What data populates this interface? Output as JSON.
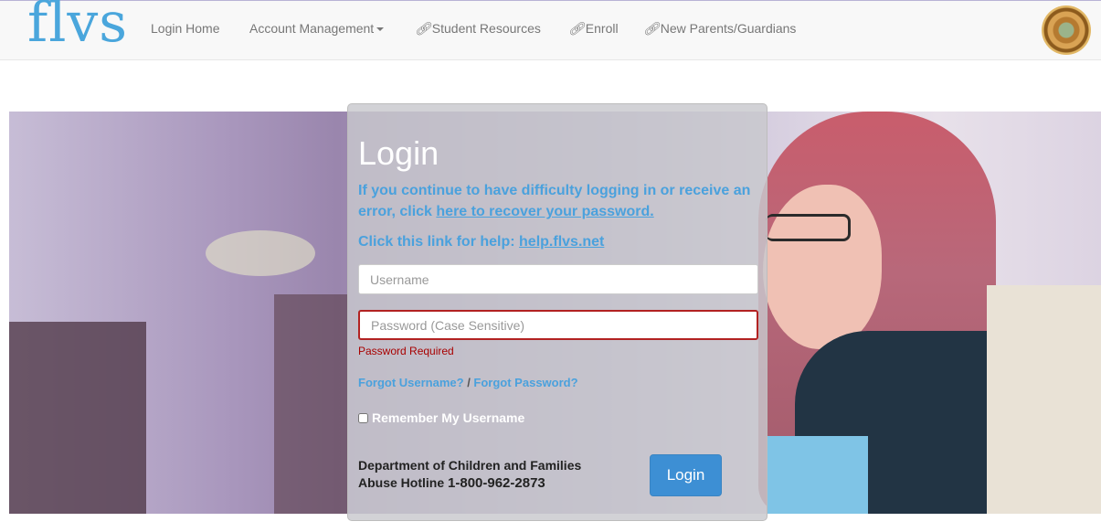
{
  "nav": {
    "brand": "flvs",
    "items": [
      {
        "label": "Login Home"
      },
      {
        "label": "Account Management"
      },
      {
        "label": "Student Resources"
      },
      {
        "label": "Enroll"
      },
      {
        "label": "New Parents/Guardians"
      }
    ]
  },
  "login": {
    "title": "Login",
    "help_prefix": "If you continue to have difficulty logging in or receive an error, click ",
    "help_link": "here to recover your password.",
    "help_line_label": "Click this link for help: ",
    "help_line_link": "help.flvs.net",
    "username_placeholder": "Username",
    "password_placeholder": "Password (Case Sensitive)",
    "password_error": "Password Required",
    "forgot_username": "Forgot Username?",
    "forgot_separator": " / ",
    "forgot_password": "Forgot Password?",
    "remember_label": "Remember My Username",
    "hotline_line1": "Department of Children and Families",
    "hotline_prefix": "Abuse Hotline ",
    "hotline_number": "1-800-962-2873",
    "button_label": "Login"
  },
  "colors": {
    "brand": "#4aa6dc",
    "link": "#4aa1dd",
    "error": "#a80000",
    "button": "#3d8fd4"
  },
  "icons": [
    "link-icon",
    "caret-down-icon",
    "florida-seal-logo"
  ]
}
